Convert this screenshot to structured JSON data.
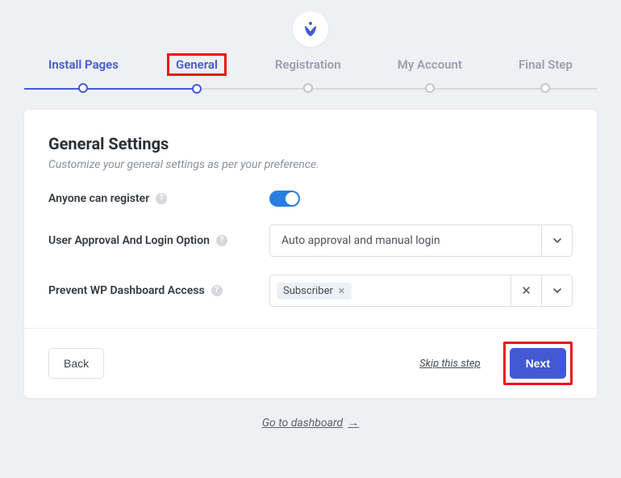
{
  "steps": [
    {
      "label": "Install Pages"
    },
    {
      "label": "General"
    },
    {
      "label": "Registration"
    },
    {
      "label": "My Account"
    },
    {
      "label": "Final Step"
    }
  ],
  "card": {
    "title": "General Settings",
    "subtitle": "Customize your general settings as per your preference."
  },
  "settings": {
    "anyone_register_label": "Anyone can register",
    "anyone_register_on": true,
    "approval_label": "User Approval And Login Option",
    "approval_value": "Auto approval and manual login",
    "prevent_label": "Prevent WP Dashboard Access",
    "prevent_tags": [
      "Subscriber"
    ]
  },
  "footer": {
    "back": "Back",
    "skip": "Skip this step",
    "next": "Next"
  },
  "dashboard_link": "Go to dashboard"
}
